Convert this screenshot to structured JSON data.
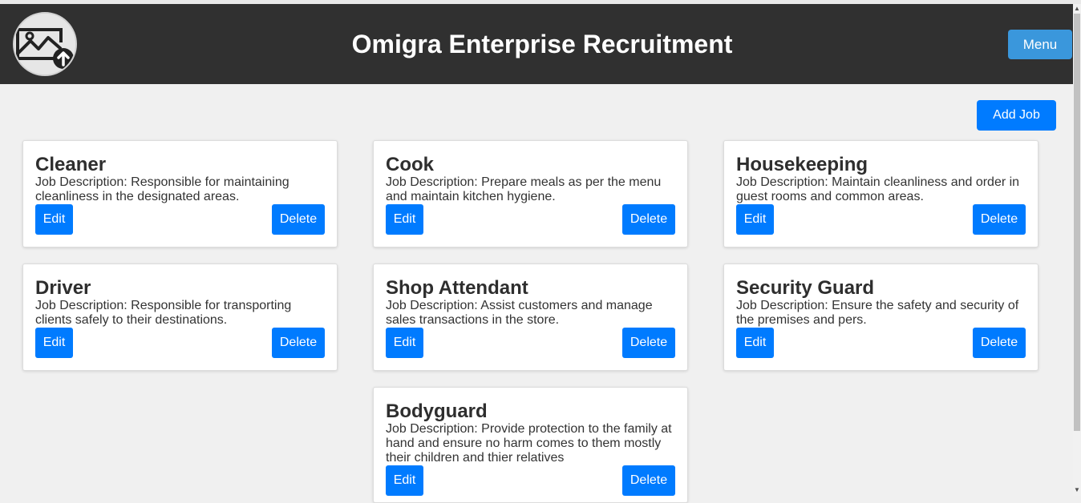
{
  "header": {
    "title": "Omigra Enterprise Recruitment",
    "menu_label": "Menu",
    "logo_icon": "image-upload-icon"
  },
  "toolbar": {
    "add_job_label": "Add Job"
  },
  "jobs": [
    {
      "title": "Cleaner",
      "description": "Job Description: Responsible for maintaining cleanliness in the designated areas.",
      "edit_label": "Edit",
      "delete_label": "Delete"
    },
    {
      "title": "Cook",
      "description": "Job Description: Prepare meals as per the menu and maintain kitchen hygiene.",
      "edit_label": "Edit",
      "delete_label": "Delete"
    },
    {
      "title": "Housekeeping",
      "description": "Job Description: Maintain cleanliness and order in guest rooms and common areas.",
      "edit_label": "Edit",
      "delete_label": "Delete"
    },
    {
      "title": "Driver",
      "description": "Job Description: Responsible for transporting clients safely to their destinations.",
      "edit_label": "Edit",
      "delete_label": "Delete"
    },
    {
      "title": "Shop Attendant",
      "description": "Job Description: Assist customers and manage sales transactions in the store.",
      "edit_label": "Edit",
      "delete_label": "Delete"
    },
    {
      "title": "Security Guard",
      "description": "Job Description: Ensure the safety and security of the premises and pers.",
      "edit_label": "Edit",
      "delete_label": "Delete"
    },
    {
      "title": "Bodyguard",
      "description": "Job Description: Provide protection to the family at hand and ensure no harm comes to them mostly their children and thier relatives",
      "edit_label": "Edit",
      "delete_label": "Delete"
    }
  ],
  "colors": {
    "header_bg": "#303030",
    "primary_button": "#007bff",
    "menu_button": "#3a97dc",
    "page_bg": "#f0f0f0"
  }
}
